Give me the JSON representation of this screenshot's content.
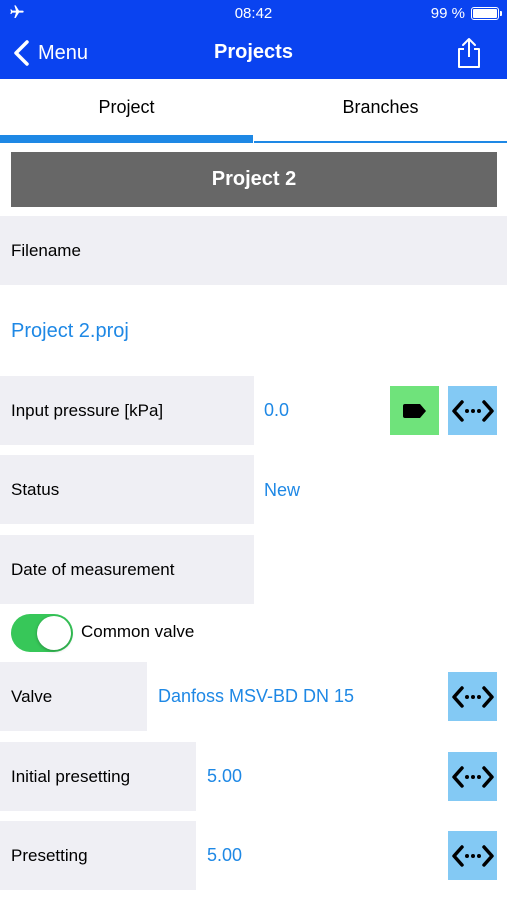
{
  "status_bar": {
    "time": "08:42",
    "battery": "99 %"
  },
  "nav": {
    "back_label": "Menu",
    "title": "Projects"
  },
  "tabs": [
    {
      "label": "Project",
      "selected": true
    },
    {
      "label": "Branches",
      "selected": false
    }
  ],
  "project_name": "Project 2",
  "fields": {
    "filename_label": "Filename",
    "filename_value": "Project 2.proj",
    "input_pressure_label": "Input pressure [kPa]",
    "input_pressure_value": "0.0",
    "status_label": "Status",
    "status_value": "New",
    "date_label": "Date of measurement",
    "date_value": "",
    "common_valve_label": "Common valve",
    "common_valve_on": true,
    "valve_label": "Valve",
    "valve_value": "Danfoss MSV-BD DN 15",
    "initial_presetting_label": "Initial presetting",
    "initial_presetting_value": "5.00",
    "presetting_label": "Presetting",
    "presetting_value": "5.00"
  },
  "colors": {
    "accent": "#0a43f0",
    "link": "#1e88e5",
    "action_button": "#83c9f4",
    "tag_button": "#6fe37b",
    "toggle_on": "#37c759"
  }
}
